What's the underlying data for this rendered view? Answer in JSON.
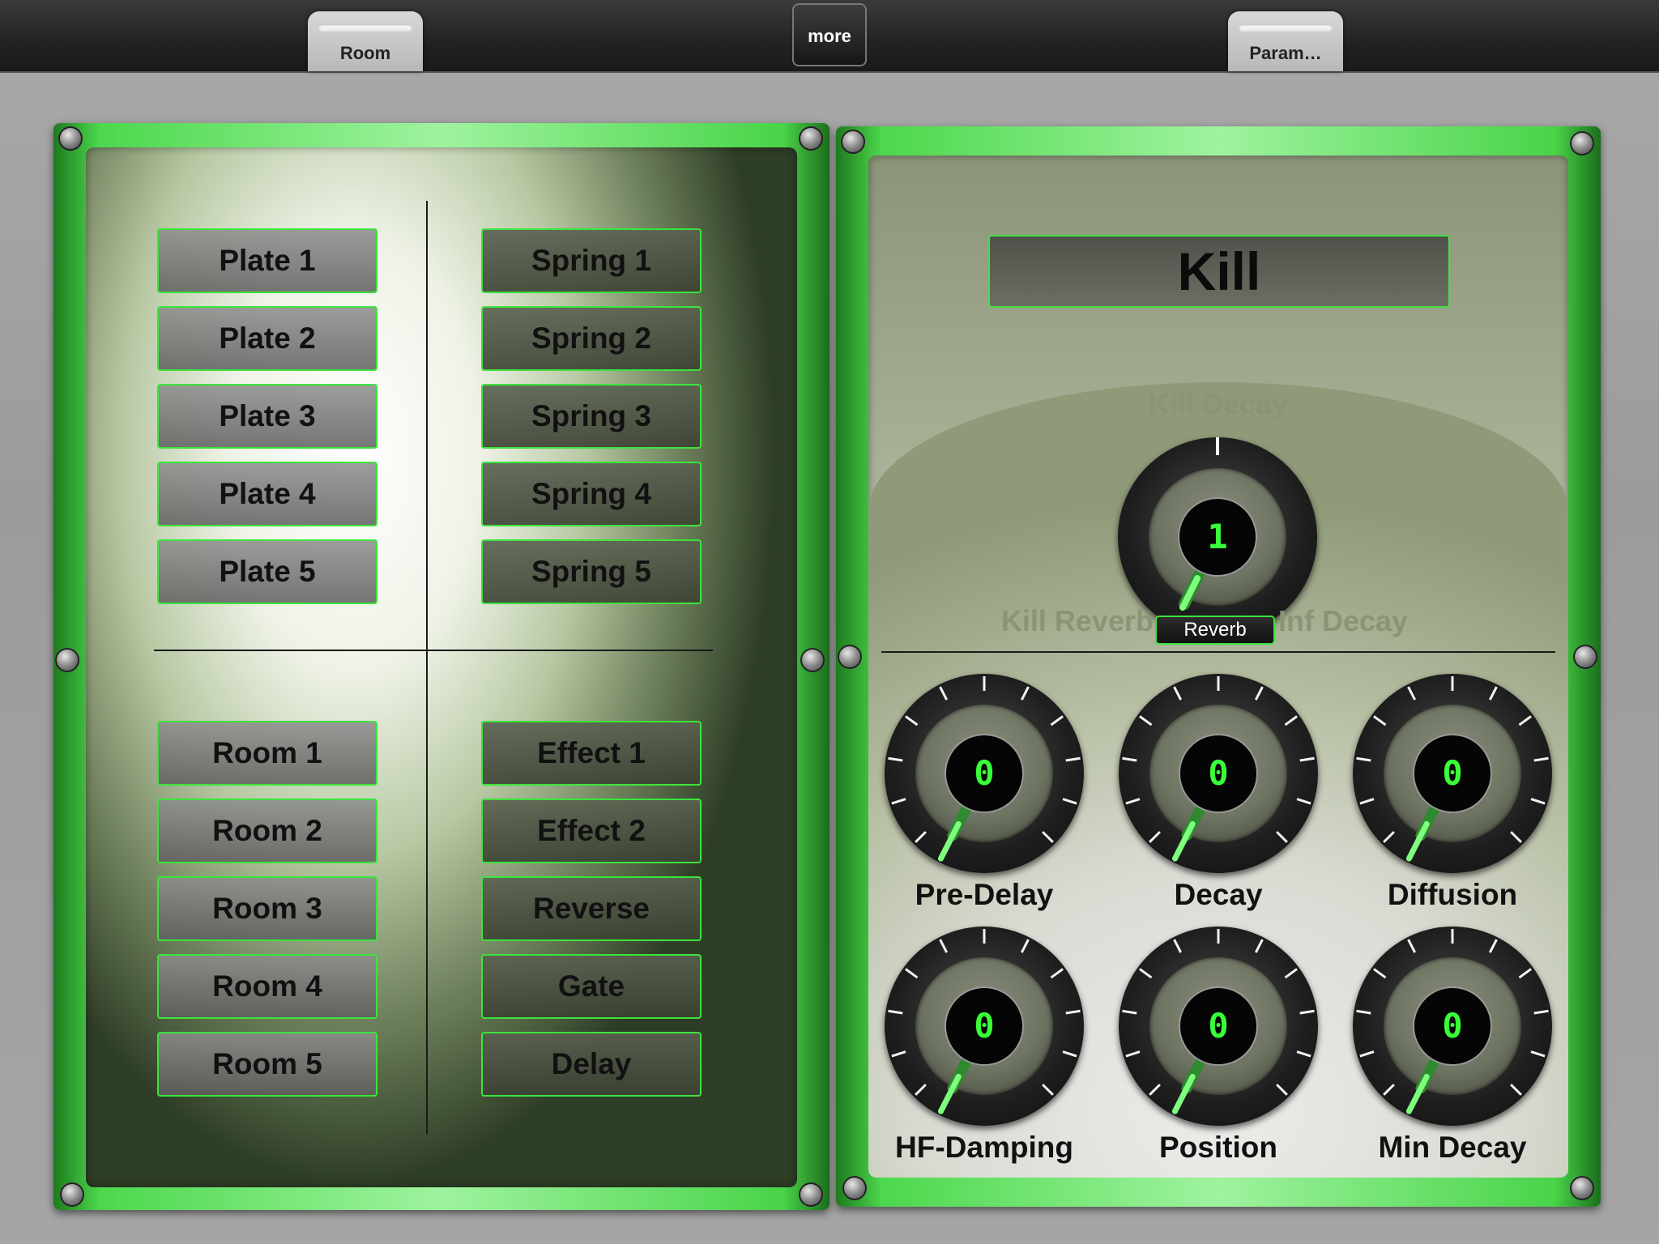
{
  "topbar": {
    "tab_left": "Room",
    "tab_right": "Param…",
    "more_label": "more"
  },
  "left_panel": {
    "plates": [
      "Plate 1",
      "Plate 2",
      "Plate 3",
      "Plate 4",
      "Plate 5"
    ],
    "springs": [
      "Spring 1",
      "Spring 2",
      "Spring 3",
      "Spring 4",
      "Spring 5"
    ],
    "rooms": [
      "Room 1",
      "Room 2",
      "Room 3",
      "Room 4",
      "Room 5"
    ],
    "effects": [
      "Effect 1",
      "Effect 2",
      "Reverse",
      "Gate",
      "Delay"
    ]
  },
  "right_panel": {
    "mode_title": "Kill",
    "kill_decay": {
      "label": "Kill Decay",
      "value": "1",
      "left_label": "Kill Reverb",
      "right_label": "Inf Decay",
      "badge": "Reverb"
    },
    "knobs": [
      {
        "label": "Pre-Delay",
        "value": "0"
      },
      {
        "label": "Decay",
        "value": "0"
      },
      {
        "label": "Diffusion",
        "value": "0"
      },
      {
        "label": "HF-Damping",
        "value": "0"
      },
      {
        "label": "Position",
        "value": "0"
      },
      {
        "label": "Min Decay",
        "value": "0"
      }
    ]
  },
  "colors": {
    "accent_green": "#3ce43c",
    "lcd_green": "#38ff38",
    "frame_green": "#4dd84d"
  }
}
